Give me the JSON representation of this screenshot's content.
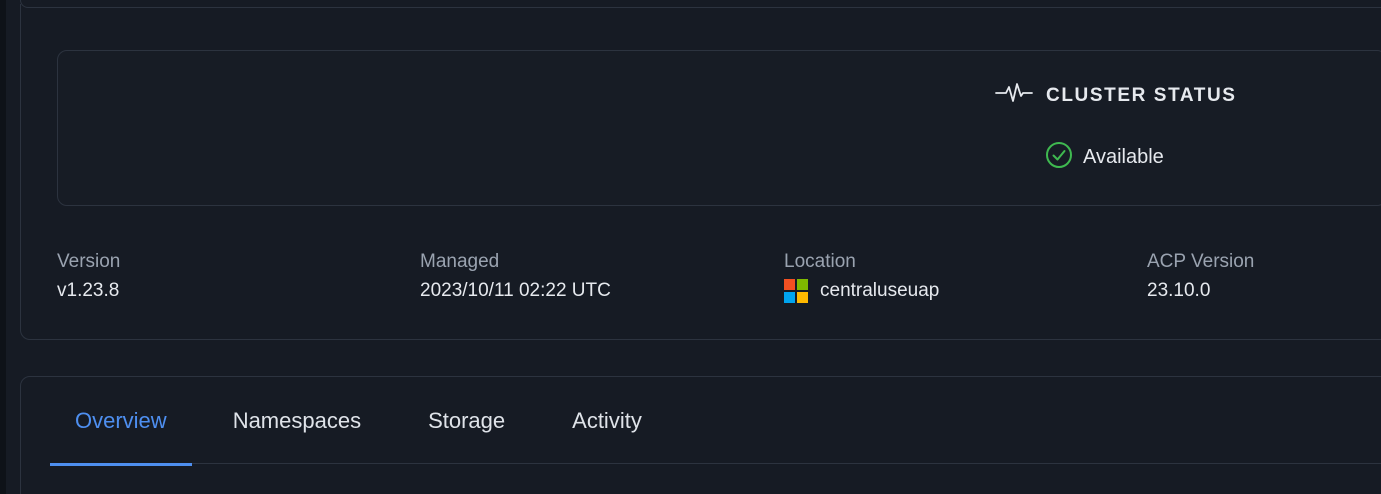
{
  "cluster_status": {
    "heading": "CLUSTER STATUS",
    "value": "Available",
    "heading_icon": "activity-pulse-icon",
    "value_icon": "check-circle-icon",
    "status_color": "#3fb950"
  },
  "details": {
    "version": {
      "label": "Version",
      "value": "v1.23.8"
    },
    "managed": {
      "label": "Managed",
      "value": "2023/10/11 02:22 UTC"
    },
    "location": {
      "label": "Location",
      "value": "centraluseuap",
      "icon": "microsoft-logo-icon"
    },
    "acp_version": {
      "label": "ACP Version",
      "value": "23.10.0"
    }
  },
  "tabs": [
    {
      "label": "Overview",
      "active": true
    },
    {
      "label": "Namespaces",
      "active": false
    },
    {
      "label": "Storage",
      "active": false
    },
    {
      "label": "Activity",
      "active": false
    }
  ],
  "colors": {
    "accent": "#4e8ff0",
    "ms_red": "#f25022",
    "ms_green": "#7fba00",
    "ms_blue": "#00a4ef",
    "ms_yellow": "#ffb900"
  }
}
